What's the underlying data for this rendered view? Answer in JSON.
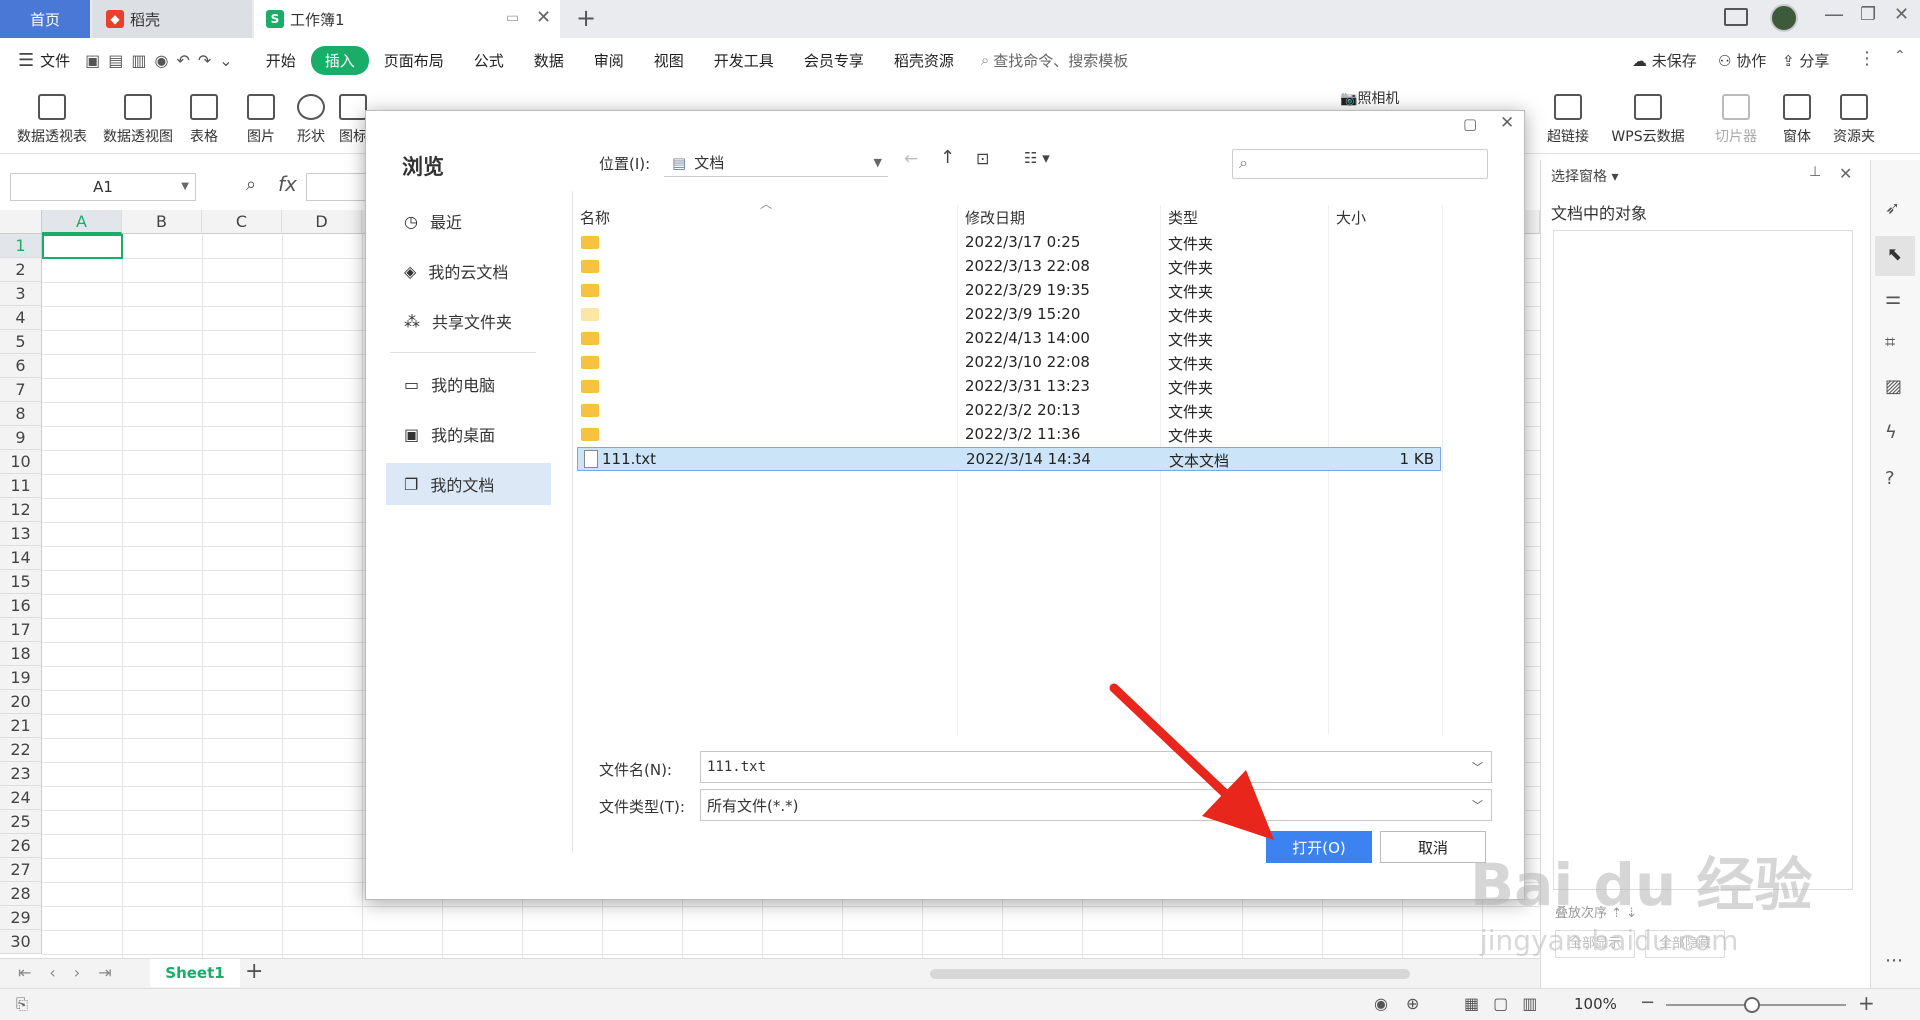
{
  "tabs": {
    "home": "首页",
    "docer": "稻壳",
    "workbook": "工作簿1",
    "workbook_icon": "S"
  },
  "menu": {
    "file": "文件",
    "items": [
      "开始",
      "插入",
      "页面布局",
      "公式",
      "数据",
      "审阅",
      "视图",
      "开发工具",
      "会员专享",
      "稻壳资源"
    ],
    "active": "插入",
    "search_placeholder": "查找命令、搜索模板",
    "unsaved": "未保存",
    "collab": "协作",
    "share": "分享"
  },
  "ribbon": {
    "left": [
      "数据透视表",
      "数据透视图",
      "表格",
      "图片",
      "形状",
      "图标"
    ],
    "camera": "照相机",
    "right": [
      "超链接",
      "WPS云数据",
      "切片器",
      "窗体",
      "资源夹"
    ]
  },
  "formula": {
    "cell_ref": "A1",
    "fx": "fx"
  },
  "sheet": {
    "columns": [
      "A",
      "B",
      "C",
      "D"
    ],
    "rows": [
      "1",
      "2",
      "3",
      "4",
      "5",
      "6",
      "7",
      "8",
      "9",
      "10",
      "11",
      "12",
      "13",
      "14",
      "15",
      "16",
      "17",
      "18",
      "19",
      "20",
      "21",
      "22",
      "23",
      "24",
      "25",
      "26",
      "27",
      "28",
      "29",
      "30"
    ],
    "tab": "Sheet1",
    "zoom": "100%"
  },
  "rightpane": {
    "title": "选择窗格",
    "subtitle": "文档中的对象",
    "btn_show": "全部显示",
    "btn_hide": "全部隐藏",
    "sort": "叠放次序"
  },
  "dialog": {
    "title": "浏览",
    "location_label": "位置(I):",
    "location_value": "文档",
    "nav": [
      "最近",
      "我的云文档",
      "共享文件夹",
      "我的电脑",
      "我的桌面",
      "我的文档"
    ],
    "nav_selected": "我的文档",
    "headers": {
      "name": "名称",
      "date": "修改日期",
      "type": "类型",
      "size": "大小"
    },
    "files": [
      {
        "name": "",
        "date": "2022/3/17 0:25",
        "type": "文件夹",
        "size": ""
      },
      {
        "name": "",
        "date": "2022/3/13 22:08",
        "type": "文件夹",
        "size": ""
      },
      {
        "name": "",
        "date": "2022/3/29 19:35",
        "type": "文件夹",
        "size": ""
      },
      {
        "name": "",
        "date": "2022/3/9 15:20",
        "type": "文件夹",
        "size": ""
      },
      {
        "name": "",
        "date": "2022/4/13 14:00",
        "type": "文件夹",
        "size": ""
      },
      {
        "name": "",
        "date": "2022/3/10 22:08",
        "type": "文件夹",
        "size": ""
      },
      {
        "name": "",
        "date": "2022/3/31 13:23",
        "type": "文件夹",
        "size": ""
      },
      {
        "name": "",
        "date": "2022/3/2 20:13",
        "type": "文件夹",
        "size": ""
      },
      {
        "name": "",
        "date": "2022/3/2 11:36",
        "type": "文件夹",
        "size": ""
      },
      {
        "name": "111.txt",
        "date": "2022/3/14 14:34",
        "type": "文本文档",
        "size": "1 KB"
      }
    ],
    "filename_label": "文件名(N):",
    "filename_value": "111.txt",
    "filetype_label": "文件类型(T):",
    "filetype_value": "所有文件(*.*)",
    "open": "打开(O)",
    "cancel": "取消"
  },
  "watermark": {
    "brand": "Bai du 经验",
    "url": "jingyan.baidu.com"
  },
  "colors": {
    "accent_green": "#1aad6a",
    "home_tab": "#4a78d7",
    "primary_button": "#3c82f0",
    "arrow": "#e8261b"
  }
}
